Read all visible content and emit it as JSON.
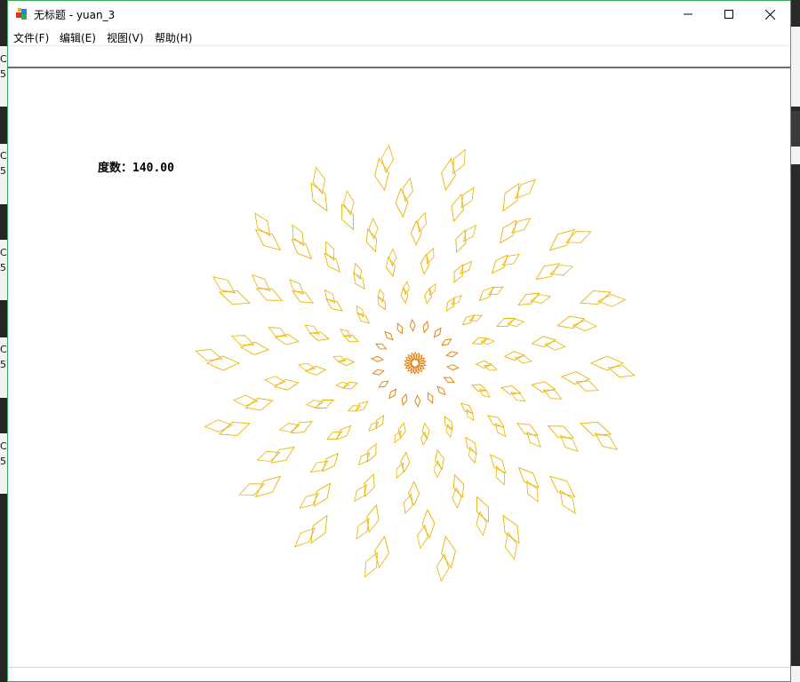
{
  "window": {
    "title": "无标题 - yuan_3",
    "controls": {
      "minimize_icon": "minimize-icon",
      "maximize_icon": "maximize-icon",
      "close_icon": "close-icon"
    }
  },
  "menu": [
    {
      "label": "文件(F)"
    },
    {
      "label": "编辑(E)"
    },
    {
      "label": "视图(V)"
    },
    {
      "label": "帮助(H)"
    }
  ],
  "canvas": {
    "degree_text": "度数：140.00",
    "rays": 18,
    "diamonds_per_ray": 7,
    "stroke_color": "#e8b400",
    "inner_stroke_color": "#e07a00"
  },
  "desktop": {
    "left_glyphs": [
      "C",
      "5",
      "C",
      "5",
      "C",
      "5",
      "C",
      "5",
      "C",
      "5"
    ]
  }
}
